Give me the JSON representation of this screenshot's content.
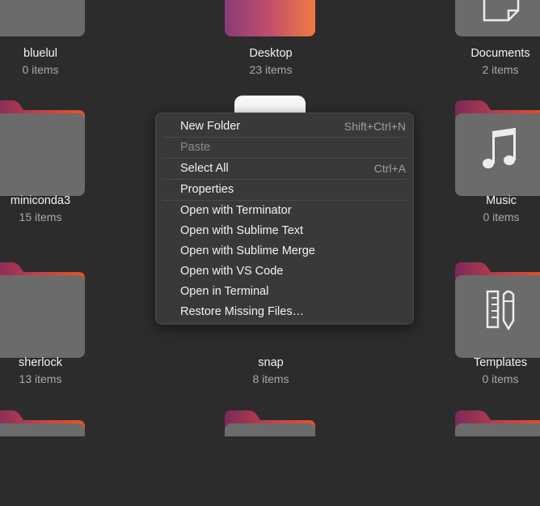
{
  "folders": [
    {
      "name": "bluelul",
      "count": "0 items"
    },
    {
      "name": "Desktop",
      "count": "23 items"
    },
    {
      "name": "Documents",
      "count": "2 items"
    },
    {
      "name": "miniconda3",
      "count": "15 items"
    },
    {
      "name": "Music",
      "count": "0 items"
    },
    {
      "name": "sherlock",
      "count": "13 items"
    },
    {
      "name": "snap",
      "count": "8 items"
    },
    {
      "name": "Templates",
      "count": "0 items"
    }
  ],
  "context_menu": {
    "items": [
      {
        "label": "New Folder",
        "accel": "Shift+Ctrl+N",
        "enabled": true
      },
      {
        "label": "Paste",
        "accel": "",
        "enabled": false
      },
      {
        "label": "Select All",
        "accel": "Ctrl+A",
        "enabled": true
      },
      {
        "label": "Properties",
        "accel": "",
        "enabled": true
      },
      {
        "label": "Open with Terminator",
        "accel": "",
        "enabled": true
      },
      {
        "label": "Open with Sublime Text",
        "accel": "",
        "enabled": true
      },
      {
        "label": "Open with Sublime Merge",
        "accel": "",
        "enabled": true
      },
      {
        "label": "Open with VS Code",
        "accel": "",
        "enabled": true
      },
      {
        "label": "Open in Terminal",
        "accel": "",
        "enabled": true
      },
      {
        "label": "Restore Missing Files…",
        "accel": "",
        "enabled": true
      }
    ]
  },
  "colors": {
    "background": "#2c2c2c",
    "folder_body": "#6b6b6b",
    "folder_tab_gradient": [
      "#8e2f5f",
      "#e95420"
    ],
    "menu_bg": "#393939"
  },
  "icons": [
    "folder-icon",
    "desktop-folder-icon",
    "documents-folder-icon",
    "music-note-icon",
    "templates-folder-icon"
  ]
}
